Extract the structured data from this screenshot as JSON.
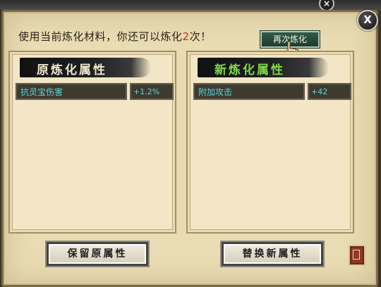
{
  "dialog": {
    "info_prefix": "使用当前炼化材料，你还可以炼化",
    "remaining_count": "2",
    "info_suffix": "次！",
    "refine_again_label": "再次炼化",
    "close_label": "X"
  },
  "left_panel": {
    "title": "原炼化属性",
    "attributes": [
      {
        "name": "抗灵宝伤害",
        "value": "+1.2%"
      }
    ]
  },
  "right_panel": {
    "title": "新炼化属性",
    "attributes": [
      {
        "name": "附加攻击",
        "value": "+42"
      }
    ]
  },
  "buttons": {
    "keep_label": "保留原属性",
    "replace_label": "替换新属性"
  },
  "colors": {
    "attribute_text": "#5bd6df",
    "new_title": "#7fd94a",
    "count_highlight": "#d22a1a",
    "parchment": "#e9dbb3"
  },
  "icons": {
    "close": "close-icon",
    "cursor": "hand-cursor-icon",
    "seal": "seal-icon"
  }
}
